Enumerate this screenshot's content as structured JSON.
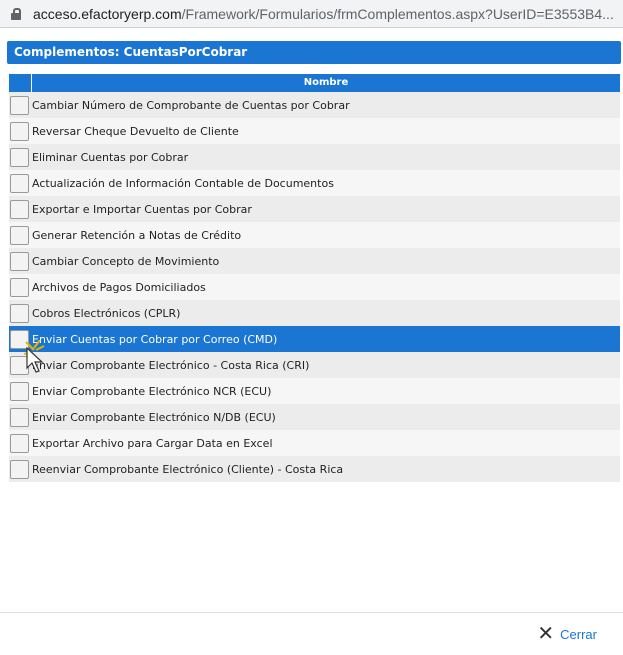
{
  "browser": {
    "url_host": "acceso.efactoryerp.com",
    "url_path": "/Framework/Formularios/frmComplementos.aspx?UserID=E3553B4..."
  },
  "dialog": {
    "title": "Complementos: CuentasPorCobrar",
    "column_header": "Nombre",
    "close_label": "Cerrar"
  },
  "items": [
    {
      "label": "Cambiar Número de Comprobante de Cuentas por Cobrar"
    },
    {
      "label": "Reversar Cheque Devuelto de Cliente"
    },
    {
      "label": "Eliminar Cuentas por Cobrar"
    },
    {
      "label": "Actualización de Información Contable de Documentos"
    },
    {
      "label": "Exportar e Importar Cuentas por Cobrar"
    },
    {
      "label": "Generar Retención a Notas de Crédito"
    },
    {
      "label": "Cambiar Concepto de Movimiento"
    },
    {
      "label": "Archivos de Pagos Domiciliados"
    },
    {
      "label": "Cobros Electrónicos (CPLR)"
    },
    {
      "label": "Enviar Cuentas por Cobrar por Correo (CMD)",
      "selected": true
    },
    {
      "label": "Enviar Comprobante Electrónico - Costa Rica (CRI)"
    },
    {
      "label": "Enviar Comprobante Electrónico NCR (ECU)"
    },
    {
      "label": "Enviar Comprobante Electrónico N/DB (ECU)"
    },
    {
      "label": "Exportar Archivo para Cargar Data en Excel"
    },
    {
      "label": "Reenviar Comprobante Electrónico (Cliente) - Costa Rica"
    }
  ],
  "colors": {
    "accent": "#1a76d2"
  }
}
